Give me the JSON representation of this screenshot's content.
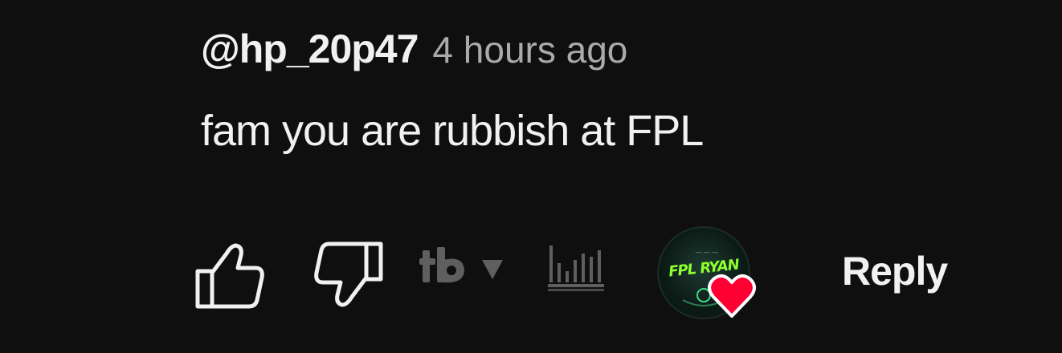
{
  "comment": {
    "author": "@hp_20p47",
    "time": "4 hours ago",
    "text": "fam you are rubbish at FPL"
  },
  "actions": {
    "like_icon": "thumbs-up-outline-icon",
    "dislike_icon": "thumbs-down-outline-icon",
    "extension_icon": "tubebuddy-icon",
    "stats_icon": "bar-stats-icon",
    "creator_heart_icon": "creator-heart-icon",
    "reply_label": "Reply",
    "avatar_logo_text": "FPL RYAN"
  },
  "colors": {
    "background": "#0f0f0f",
    "primary_text": "#f1f1f1",
    "secondary_text": "#aaaaaa",
    "heart": "#ff0033",
    "muted_icon": "#5f5f5f"
  }
}
